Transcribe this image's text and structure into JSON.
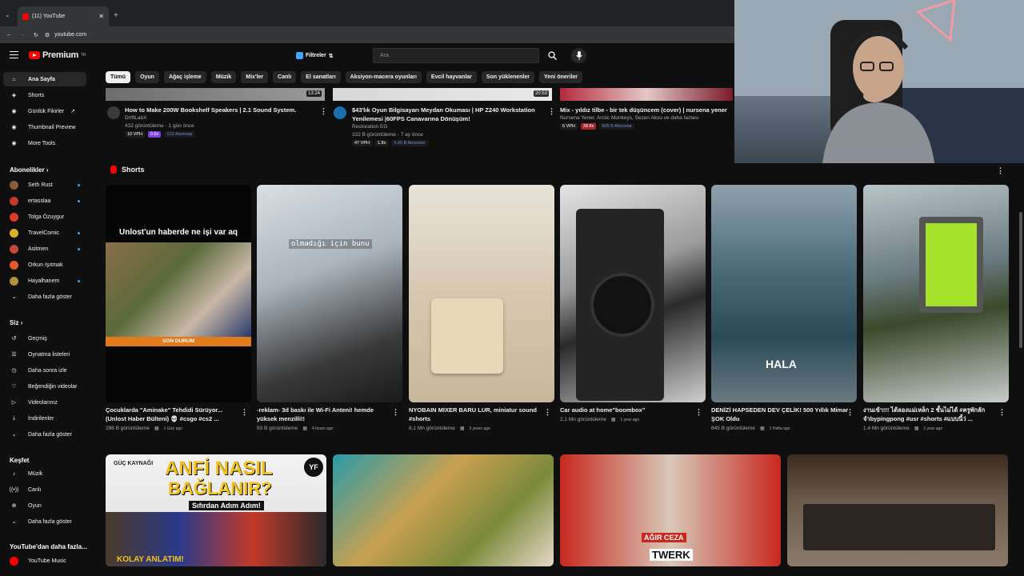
{
  "browser": {
    "tab_title": "(11) YouTube",
    "url": "youtube.com"
  },
  "header": {
    "logo_text": "Premium",
    "logo_sup": "TR",
    "filters_label": "Filtreler",
    "search_placeholder": "Ara"
  },
  "chips": [
    "Tümü",
    "Oyun",
    "Ağaç işleme",
    "Müzik",
    "Mix'ler",
    "Canlı",
    "El sanatları",
    "Aksiyon-macera oyunları",
    "Evcil hayvanlar",
    "Son yüklenenler",
    "Yeni öneriler"
  ],
  "sidebar": {
    "main": [
      "Ana Sayfa",
      "Shorts",
      "Günlük Fikirler",
      "Thumbnail Preview",
      "More Tools"
    ],
    "subs_header": "Abonelikler",
    "subs": [
      "Seth Rust",
      "ertasslaa",
      "Tolga Özuygur",
      "TravelComic",
      "Asitmen",
      "Orkun Işıtmak",
      "Hayalhanem"
    ],
    "subs_more": "Daha fazla göster",
    "you_header": "Siz",
    "you": [
      "Geçmiş",
      "Oynatma listeleri",
      "Daha sonra izle",
      "Beğendiğin videolar",
      "Videolarınız",
      "İndirilenler",
      "Daha fazla göster"
    ],
    "explore_header": "Keşfet",
    "explore": [
      "Müzik",
      "Canlı",
      "Oyun",
      "Daha fazla göster"
    ],
    "more_header": "YouTube'dan daha fazla...",
    "more": [
      "YouTube Music"
    ]
  },
  "top_videos": [
    {
      "duration": "13:24",
      "title": "How to Make 200W Bookshelf Speakers | 2.1 Sound System.",
      "channel": "DrIftLabX",
      "meta": "432 görüntüleme · 1 gün önce",
      "badges": [
        "10 VPH",
        "0.8x",
        "122 Abonelar"
      ]
    },
    {
      "duration": "20:53",
      "title": "$43'lık Oyun Bilgisayarı Meydan Okuması | HP Z240 Workstation Yenilemesi |60FPS Canavarına Dönüşüm!",
      "channel": "Restoration EG",
      "meta": "332 B görüntüleme · 7 ay önce",
      "badges": [
        "47 VPH",
        "1.8x",
        "5.65 B Abonelar"
      ]
    },
    {
      "duration": "",
      "title": "Mix - yıldız tilbe - bir tek düşüncem (cover) | nursena yener",
      "channel": "Nursena Yener, Arctic Monkeys, Sezen Aksu ve daha fazlası",
      "meta": "",
      "badges": [
        "6 VPH",
        "38.8x",
        "605 B Abonelar"
      ]
    }
  ],
  "shorts_header": "Shorts",
  "shorts": [
    {
      "title": "Çocuklarda \"Aminake\" Tehdidi Sürüyor... (Unlost Haber Bülteni) 💀 #csgo #cs2 ...",
      "views": "288 B görüntüleme",
      "when": "1 Gün ago",
      "overlay": "Unlost'un haberde ne işi var aq",
      "overlay2": "SON DURUM"
    },
    {
      "title": "-reklam- 3d baskı ile Wi-Fi Anteni! hemde yüksek menzilli!!",
      "views": "93 B görüntüleme",
      "when": "4 hours ago",
      "overlay": "olmadığı için bunu"
    },
    {
      "title": "NYOBAIN MIXER BARU LUR, miniatur sound #shorts",
      "views": "8,1 Mn görüntüleme",
      "when": "3 years ago"
    },
    {
      "title": "Car audio at home\"boombox\"",
      "views": "2,1 Mn görüntüleme",
      "when": "1 year ago"
    },
    {
      "title": "DENİZİ HAPSEDEN DEV ÇELİK! 500 Yıllık Mimar ŞOK Oldu",
      "views": "645 B görüntüleme",
      "when": "1 Hafta ago",
      "overlay": "HALA"
    },
    {
      "title": "งานเข้า!!! ได้ลองแม่เหล็ก 2 ชั้นไม่ได้ #ครูพักลัก จำbypingpong #usr #shorts #แบบนี้ว่ ...",
      "views": "1,4 Mn görüntüleme",
      "when": "1 year ago"
    }
  ],
  "bottom_thumbs": [
    {
      "l1": "GÜÇ KAYNAĞI",
      "l2": "ANFİ NASIL",
      "l3": "BAĞLANIR?",
      "l4": "Sıfırdan Adım Adım!",
      "l5": "KOLAY ANLATIM!",
      "badge": "YF"
    },
    {},
    {
      "l1": "AĞIR CEZA",
      "l2": "TWERK"
    },
    {}
  ],
  "colors": {
    "bg": "#0f0f0f",
    "accent": "#ff0000",
    "link": "#3ea6ff"
  }
}
